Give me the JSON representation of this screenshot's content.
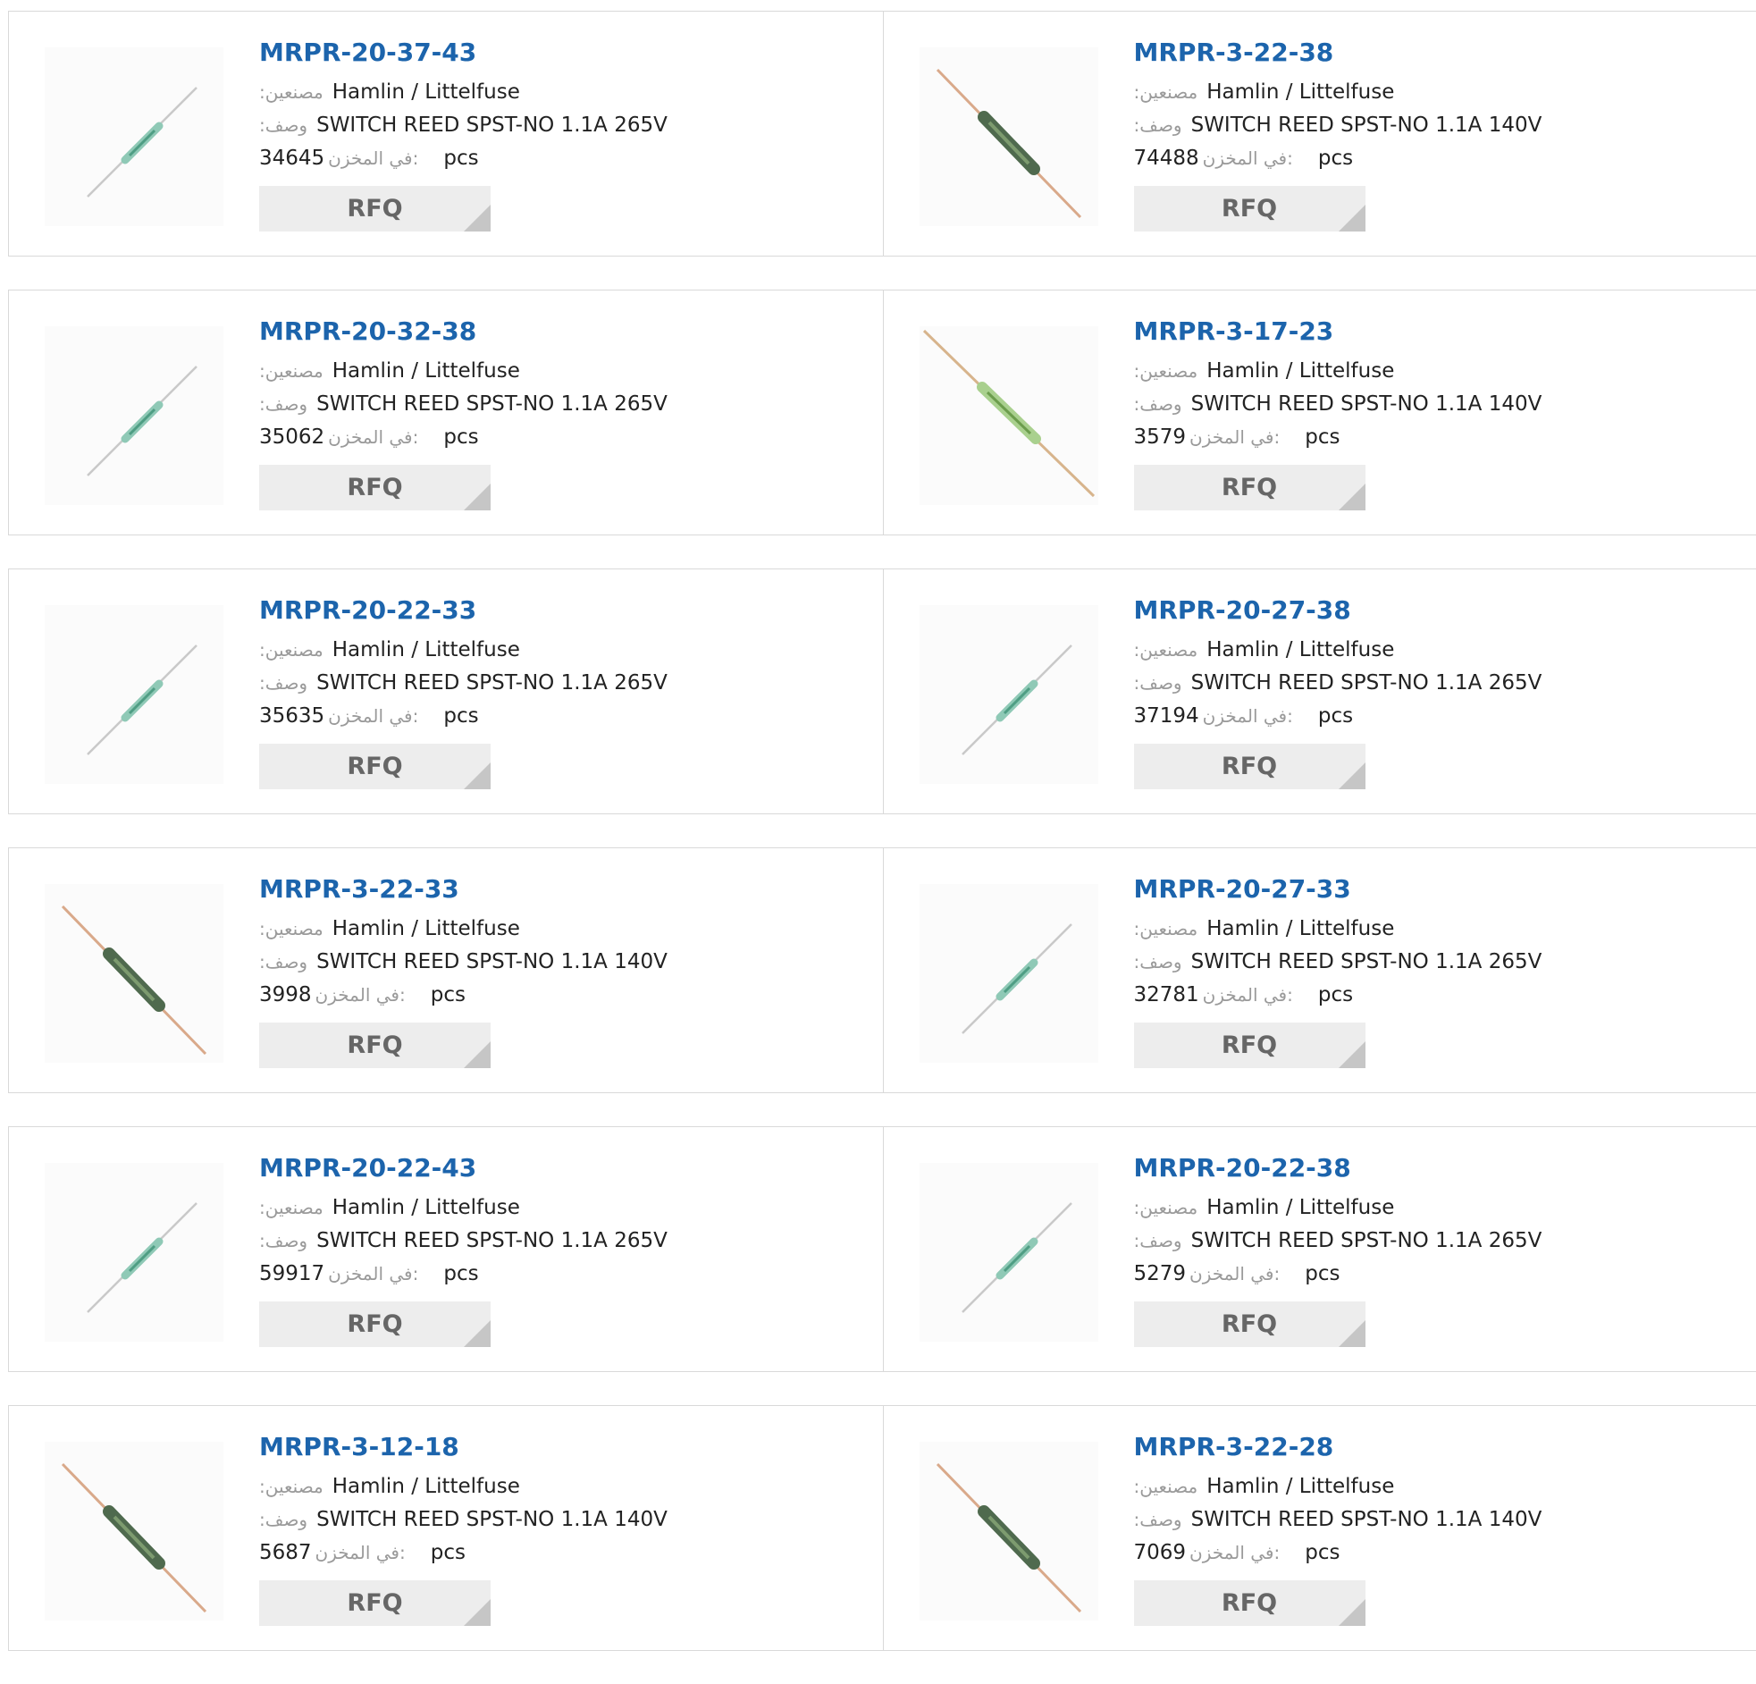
{
  "labels": {
    "manufacturer": ":مصنعين",
    "description": ":وصف",
    "stock": "في المخزن:",
    "unit": "pcs",
    "rfq": "RFQ"
  },
  "colors": {
    "title": "#1c64ac",
    "button_bg": "#ededed",
    "button_corner": "#c6c6c6",
    "border": "#d9d9d9"
  },
  "products": [
    {
      "part": "MRPR-20-37-43",
      "manufacturer": "Hamlin / Littelfuse",
      "description": "SWITCH REED SPST-NO 1.1A 265V",
      "stock": "34645",
      "image": "reed-switch-small-icon"
    },
    {
      "part": "MRPR-3-22-38",
      "manufacturer": "Hamlin / Littelfuse",
      "description": "SWITCH REED SPST-NO 1.1A 140V",
      "stock": "74488",
      "image": "reed-switch-large-icon"
    },
    {
      "part": "MRPR-20-32-38",
      "manufacturer": "Hamlin / Littelfuse",
      "description": "SWITCH REED SPST-NO 1.1A 265V",
      "stock": "35062",
      "image": "reed-switch-small-icon"
    },
    {
      "part": "MRPR-3-17-23",
      "manufacturer": "Hamlin / Littelfuse",
      "description": "SWITCH REED SPST-NO 1.1A 140V",
      "stock": "3579",
      "image": "reed-switch-long-green-icon"
    },
    {
      "part": "MRPR-20-22-33",
      "manufacturer": "Hamlin / Littelfuse",
      "description": "SWITCH REED SPST-NO 1.1A 265V",
      "stock": "35635",
      "image": "reed-switch-small-icon"
    },
    {
      "part": "MRPR-20-27-38",
      "manufacturer": "Hamlin / Littelfuse",
      "description": "SWITCH REED SPST-NO 1.1A 265V",
      "stock": "37194",
      "image": "reed-switch-small-icon"
    },
    {
      "part": "MRPR-3-22-33",
      "manufacturer": "Hamlin / Littelfuse",
      "description": "SWITCH REED SPST-NO 1.1A 140V",
      "stock": "3998",
      "image": "reed-switch-large-icon"
    },
    {
      "part": "MRPR-20-27-33",
      "manufacturer": "Hamlin / Littelfuse",
      "description": "SWITCH REED SPST-NO 1.1A 265V",
      "stock": "32781",
      "image": "reed-switch-small-icon"
    },
    {
      "part": "MRPR-20-22-43",
      "manufacturer": "Hamlin / Littelfuse",
      "description": "SWITCH REED SPST-NO 1.1A 265V",
      "stock": "59917",
      "image": "reed-switch-small-icon"
    },
    {
      "part": "MRPR-20-22-38",
      "manufacturer": "Hamlin / Littelfuse",
      "description": "SWITCH REED SPST-NO 1.1A 265V",
      "stock": "5279",
      "image": "reed-switch-small-icon"
    },
    {
      "part": "MRPR-3-12-18",
      "manufacturer": "Hamlin / Littelfuse",
      "description": "SWITCH REED SPST-NO 1.1A 140V",
      "stock": "5687",
      "image": "reed-switch-large-icon"
    },
    {
      "part": "MRPR-3-22-28",
      "manufacturer": "Hamlin / Littelfuse",
      "description": "SWITCH REED SPST-NO 1.1A 140V",
      "stock": "7069",
      "image": "reed-switch-large-icon"
    }
  ]
}
